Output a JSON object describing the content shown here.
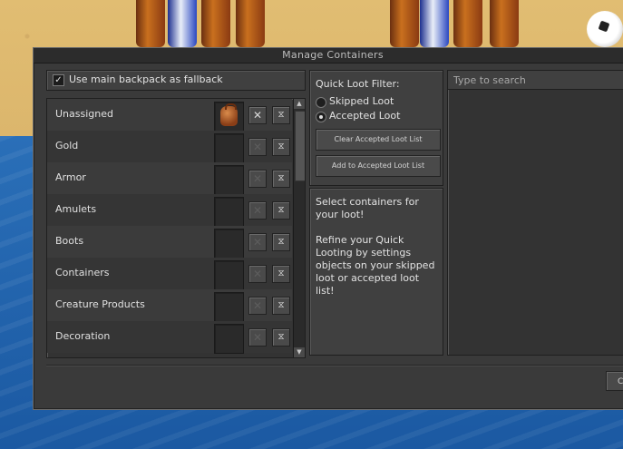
{
  "window": {
    "title": "Manage Containers"
  },
  "fallback": {
    "label": "Use main backpack as fallback",
    "checked": true,
    "check_glyph": "✓"
  },
  "categories": [
    {
      "label": "Unassigned",
      "has_container": true,
      "x_glyph": "✕",
      "icon_glyph": "⧖"
    },
    {
      "label": "Gold",
      "has_container": false,
      "x_glyph": "✕",
      "icon_glyph": "⧖"
    },
    {
      "label": "Armor",
      "has_container": false,
      "x_glyph": "✕",
      "icon_glyph": "⧖"
    },
    {
      "label": "Amulets",
      "has_container": false,
      "x_glyph": "✕",
      "icon_glyph": "⧖"
    },
    {
      "label": "Boots",
      "has_container": false,
      "x_glyph": "✕",
      "icon_glyph": "⧖"
    },
    {
      "label": "Containers",
      "has_container": false,
      "x_glyph": "✕",
      "icon_glyph": "⧖"
    },
    {
      "label": "Creature Products",
      "has_container": false,
      "x_glyph": "✕",
      "icon_glyph": "⧖"
    },
    {
      "label": "Decoration",
      "has_container": false,
      "x_glyph": "✕",
      "icon_glyph": "⧖"
    }
  ],
  "scroll": {
    "up_glyph": "▲",
    "down_glyph": "▼"
  },
  "quick_loot": {
    "title": "Quick Loot Filter:",
    "options": [
      {
        "label": "Skipped Loot",
        "selected": false
      },
      {
        "label": "Accepted Loot",
        "selected": true
      }
    ],
    "clear_button": "Clear Accepted Loot List",
    "add_button": "Add to Accepted Loot List"
  },
  "info": {
    "text": "Select containers for your loot!\n\nRefine your Quick Looting by settings objects on your skipped loot or accepted loot list!"
  },
  "search": {
    "placeholder": "Type to search",
    "value": ""
  },
  "footer": {
    "close_label": "C"
  },
  "colors": {
    "window_bg": "#3a3a3a",
    "panel_bg": "#404040",
    "text": "#e2e2e2",
    "sand": "#e1bd72",
    "water": "#2a6fb8"
  }
}
